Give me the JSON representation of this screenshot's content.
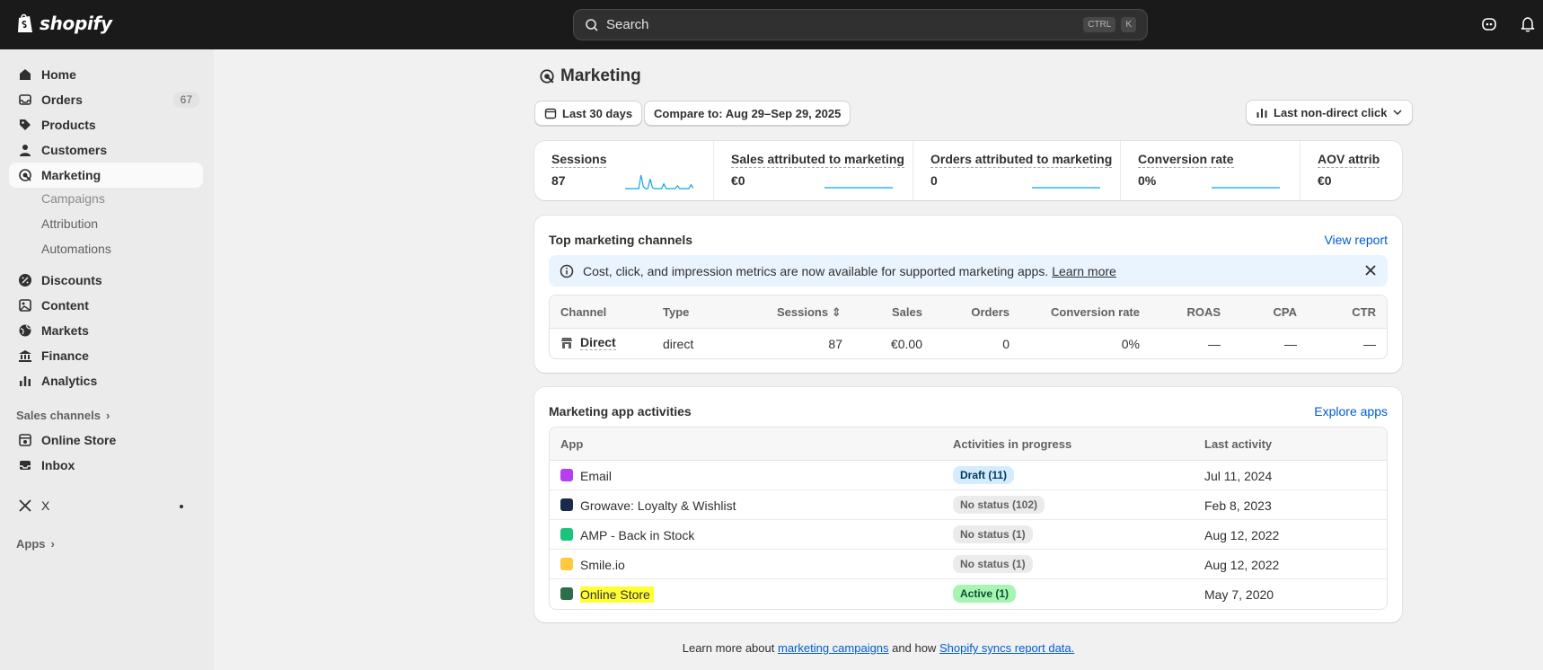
{
  "topbar": {
    "logo_text": "shopify",
    "search_placeholder": "Search",
    "shortcut_1": "CTRL",
    "shortcut_2": "K"
  },
  "sidebar": {
    "items": [
      {
        "label": "Home",
        "icon": "home-icon"
      },
      {
        "label": "Orders",
        "icon": "inbox-icon",
        "badge": "67"
      },
      {
        "label": "Products",
        "icon": "tag-icon"
      },
      {
        "label": "Customers",
        "icon": "person-icon"
      },
      {
        "label": "Marketing",
        "icon": "target-icon",
        "active": true
      },
      {
        "label": "Discounts",
        "icon": "discount-icon"
      },
      {
        "label": "Content",
        "icon": "content-icon"
      },
      {
        "label": "Markets",
        "icon": "globe-icon"
      },
      {
        "label": "Finance",
        "icon": "bank-icon"
      },
      {
        "label": "Analytics",
        "icon": "bar-chart-icon"
      }
    ],
    "marketing_sub": [
      "Campaigns",
      "Attribution",
      "Automations"
    ],
    "sales_channels_label": "Sales channels",
    "channels": [
      {
        "label": "Online Store",
        "icon": "store-icon"
      },
      {
        "label": "Inbox",
        "icon": "inbox-icon"
      }
    ],
    "x_app": "X",
    "apps_label": "Apps"
  },
  "page": {
    "title": "Marketing",
    "date_range": "Last 30 days",
    "compare": "Compare to: Aug 29–Sep 29, 2025",
    "attribution_model": "Last non-direct click"
  },
  "metrics": [
    {
      "label": "Sessions",
      "value": "87",
      "spark": [
        0,
        0,
        0,
        0,
        0,
        0,
        0,
        14,
        2,
        0,
        0,
        10,
        1,
        0,
        0,
        0,
        0,
        5,
        0,
        0,
        0,
        0,
        0,
        3,
        0,
        0,
        0,
        0,
        0,
        4,
        0
      ]
    },
    {
      "label": "Sales attributed to marketing",
      "value": "€0"
    },
    {
      "label": "Orders attributed to marketing",
      "value": "0"
    },
    {
      "label": "Conversion rate",
      "value": "0%"
    },
    {
      "label": "AOV attrib",
      "value": "€0"
    }
  ],
  "top_channels": {
    "title": "Top marketing channels",
    "link": "View report",
    "banner_text": "Cost, click, and impression metrics are now available for supported marketing apps.",
    "banner_link": "Learn more",
    "columns": [
      "Channel",
      "Type",
      "Sessions",
      "Sales",
      "Orders",
      "Conversion rate",
      "ROAS",
      "CPA",
      "CTR"
    ],
    "rows": [
      {
        "channel": "Direct",
        "type": "direct",
        "sessions": "87",
        "sales": "€0.00",
        "orders": "0",
        "conversion": "0%",
        "roas": "—",
        "cpa": "—",
        "ctr": "—"
      }
    ]
  },
  "app_activities": {
    "title": "Marketing app activities",
    "link": "Explore apps",
    "columns": [
      "App",
      "Activities in progress",
      "Last activity"
    ],
    "rows": [
      {
        "app": "Email",
        "status": "Draft (11)",
        "last": "Jul 11, 2024",
        "color": "#b83df0"
      },
      {
        "app": "Growave: Loyalty & Wishlist",
        "status": "No status (102)",
        "last": "Feb 8, 2023",
        "color": "#1a2a4a"
      },
      {
        "app": "AMP - Back in Stock",
        "status": "No status (1)",
        "last": "Aug 12, 2022",
        "color": "#1bc47d"
      },
      {
        "app": "Smile.io",
        "status": "No status (1)",
        "last": "Aug 12, 2022",
        "color": "#ffc83d"
      },
      {
        "app": "Online Store",
        "status": "Active (1)",
        "last": "May 7, 2020",
        "color": "#2c6e49"
      }
    ]
  },
  "footer": {
    "prefix": "Learn more about",
    "link1": "marketing campaigns",
    "middle": "and how",
    "link2": "Shopify syncs report data."
  }
}
